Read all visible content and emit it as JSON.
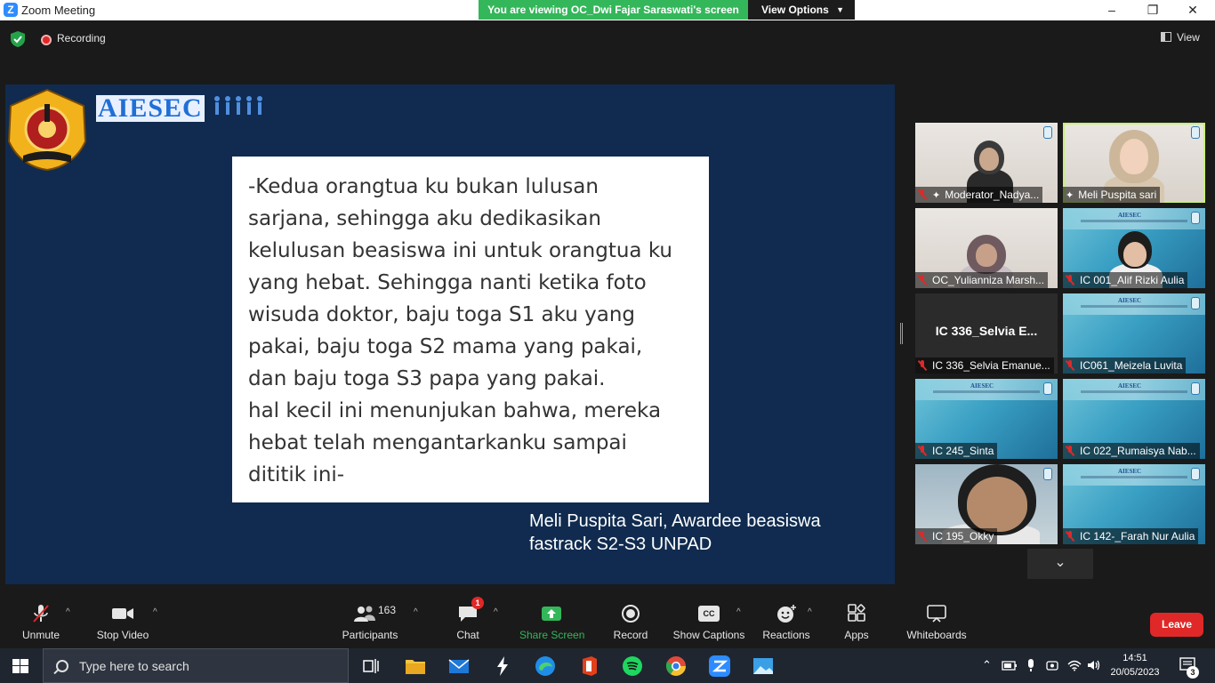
{
  "window": {
    "title": "Zoom Meeting",
    "viewing_banner": "You are viewing OC_Dwi Fajar Saraswati's screen",
    "view_options_label": "View Options",
    "minimize": "–",
    "maximize": "❐",
    "close": "✕"
  },
  "top": {
    "recording_label": "Recording",
    "view_label": "View"
  },
  "shared": {
    "brand": "AIESEC",
    "quote_lines": [
      "-Kedua orangtua ku bukan lulusan",
      "sarjana, sehingga aku dedikasikan",
      "kelulusan beasiswa ini untuk orangtua ku",
      "yang hebat. Sehingga nanti ketika foto",
      "wisuda doktor, baju toga S1 aku yang",
      "pakai, baju toga S2 mama yang pakai,",
      "dan baju toga S3 papa yang pakai.",
      "hal kecil ini menunjukan bahwa, mereka",
      "hebat telah mengantarkanku sampai",
      "dititik ini-"
    ],
    "caption_lines": [
      "Meli Puspita Sari, Awardee beasiswa",
      "fastrack S2-S3 UNPAD"
    ]
  },
  "gallery": {
    "tiles": [
      {
        "name": "Moderator_Nadya...",
        "pinned": true,
        "muted": true,
        "kind": "photo"
      },
      {
        "name": "Meli Puspita sari",
        "pinned": true,
        "muted": false,
        "kind": "photo",
        "active": true
      },
      {
        "name": "OC_Yulianniza Marsh...",
        "pinned": false,
        "muted": true,
        "kind": "photo"
      },
      {
        "name": "IC 001_Alif Rizki Aulia",
        "pinned": false,
        "muted": true,
        "kind": "slide"
      },
      {
        "name": "IC 336_Selvia Emanue...",
        "pinned": false,
        "muted": true,
        "kind": "dark",
        "center_label": "IC 336_Selvia E..."
      },
      {
        "name": "IC061_Meizela Luvita",
        "pinned": false,
        "muted": true,
        "kind": "slide"
      },
      {
        "name": "IC 245_Sinta",
        "pinned": false,
        "muted": true,
        "kind": "slide"
      },
      {
        "name": "IC 022_Rumaisya Nab...",
        "pinned": false,
        "muted": true,
        "kind": "slide"
      },
      {
        "name": "IC 195_Okky",
        "pinned": false,
        "muted": true,
        "kind": "photo"
      },
      {
        "name": "IC 142-_Farah Nur Aulia",
        "pinned": false,
        "muted": true,
        "kind": "slide"
      }
    ],
    "mini_logo": "AIESEC",
    "next_page": "⌄"
  },
  "toolbar": {
    "unmute": "Unmute",
    "stop_video": "Stop Video",
    "participants": "Participants",
    "participants_count": "163",
    "chat": "Chat",
    "chat_badge": "1",
    "share_screen": "Share Screen",
    "record": "Record",
    "show_captions": "Show Captions",
    "captions_icon": "CC",
    "reactions": "Reactions",
    "apps": "Apps",
    "whiteboards": "Whiteboards",
    "leave": "Leave",
    "caret": "^"
  },
  "taskbar": {
    "search_placeholder": "Type here to search",
    "time": "14:51",
    "date": "20/05/2023",
    "notifications": "3"
  },
  "colors": {
    "accent_green": "#34b75a",
    "leave_red": "#e02828",
    "zoom_blue": "#2d8cff",
    "share_bg": "#102b4f",
    "active_tile_border": "#c8f07a"
  }
}
